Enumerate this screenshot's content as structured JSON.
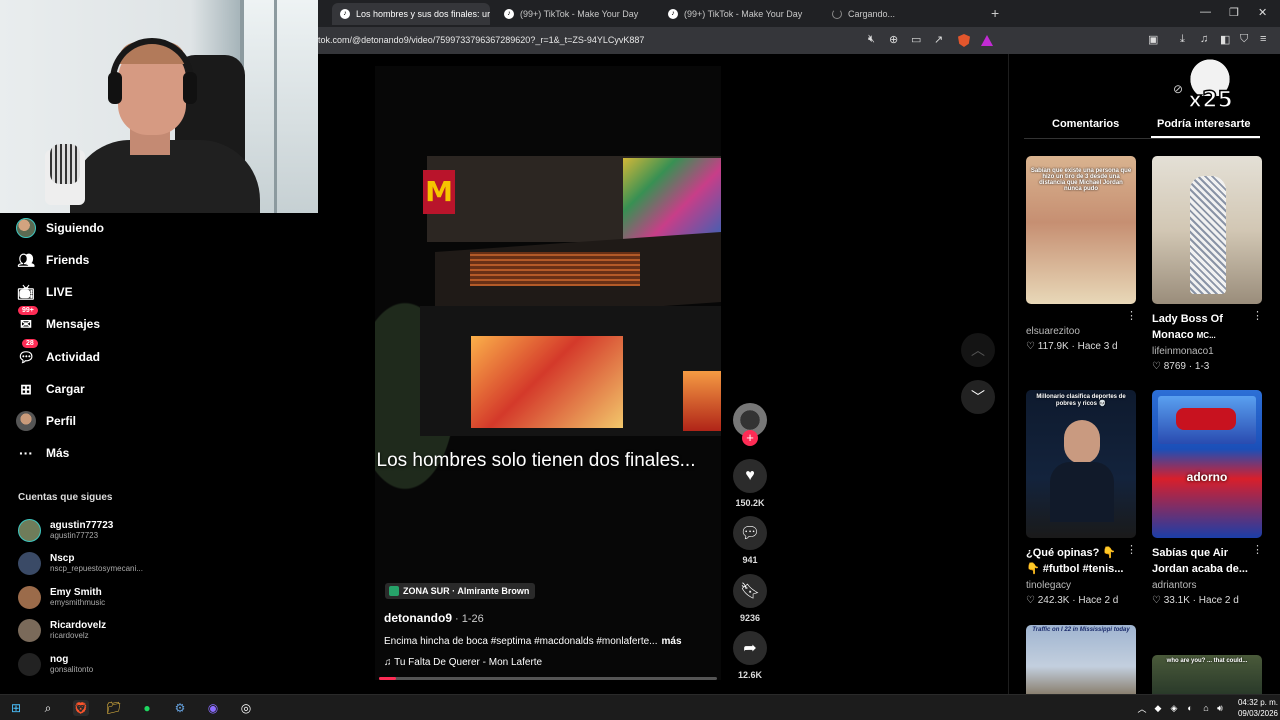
{
  "browser": {
    "tabs": [
      {
        "label": "Los hombres y sus dos finales: ur",
        "close": "✕",
        "active": true
      },
      {
        "label": "(99+) TikTok - Make Your Day",
        "active": false
      },
      {
        "label": "(99+) TikTok - Make Your Day",
        "active": false
      },
      {
        "label": "Cargando...",
        "active": false
      }
    ],
    "new_tab": "+",
    "url": "tok.com/@detonando9/video/7599733796367289620?_r=1&_t=ZS-94YLCyvK887",
    "window_controls": [
      "—",
      "❐",
      "✕"
    ]
  },
  "sidebar": {
    "items": [
      {
        "label": "Siguiendo",
        "icon": "avatar-icon"
      },
      {
        "label": "Friends",
        "icon": "friends-icon"
      },
      {
        "label": "LIVE",
        "icon": "live-icon"
      },
      {
        "label": "Mensajes",
        "icon": "messages-icon",
        "badge": "99+"
      },
      {
        "label": "Actividad",
        "icon": "activity-icon",
        "badge": "28"
      },
      {
        "label": "Cargar",
        "icon": "upload-icon"
      },
      {
        "label": "Perfil",
        "icon": "profile-icon"
      },
      {
        "label": "Más",
        "icon": "more-icon"
      }
    ],
    "following_title": "Cuentas que sigues",
    "accounts": [
      {
        "name": "agustin77723",
        "handle": "agustin77723",
        "color": "#6f7c5a"
      },
      {
        "name": "Nscp",
        "handle": "nscp_repuestosymecani...",
        "color": "#3a4a66"
      },
      {
        "name": "Emy Smith",
        "handle": "emysmithmusic",
        "color": "#9b6b4a"
      },
      {
        "name": "Ricardovelz",
        "handle": "ricardovelz",
        "color": "#7a6a5a"
      },
      {
        "name": "nog",
        "handle": "gonsalitonto",
        "color": "#222222"
      }
    ]
  },
  "video": {
    "caption": "Los hombres solo tienen dos finales...",
    "location": "ZONA SUR · Almirante Brown",
    "author": "detonando9",
    "date": " · 1-26",
    "description": "Encima hincha de boca #septima #macdonalds #monlaferte...",
    "more": "más",
    "music": "♫  Tu Falta De Querer - Mon Laferte",
    "progress": 0.05
  },
  "actions": {
    "likes": "150.2K",
    "comments": "941",
    "saves": "9236",
    "shares": "12.6K"
  },
  "right_panel": {
    "tabs": [
      "Comentarios",
      "Podría interesarte"
    ],
    "active_tab": "Podría interesarte",
    "overlay_text": "x25",
    "cards": [
      {
        "title": "",
        "author": "elsuarezitoo",
        "likes": "117.9K",
        "time": "Hace 3 d",
        "thumb_text": "Sabían que existe una persona que hizo un tiro de 3 desde una distancia que Michael Jordan nunca pudo"
      },
      {
        "title": "Lady Boss Of Monaco",
        "title_suffix": "MC...",
        "author": "lifeinmonaco1",
        "likes": "8769",
        "time": "1-3",
        "thumb_text": ""
      },
      {
        "title": "¿Qué opinas? 👇👇 #futbol #tenis...",
        "author": "tinolegacy",
        "likes": "242.3K",
        "time": "Hace 2 d",
        "thumb_text": "Millonario clasifica deportes de pobres y ricos 💀"
      },
      {
        "title": "Sabías que Air Jordan acaba de...",
        "author": "adriantors",
        "likes": "33.1K",
        "time": "Hace 2 d",
        "thumb_text": "adorno"
      },
      {
        "title": "",
        "author": "",
        "likes": "",
        "time": "",
        "thumb_text": "Traffic on I 22 in Mississippi today"
      },
      {
        "title": "",
        "author": "",
        "likes": "",
        "time": "",
        "thumb_text": "who are you? ... that could..."
      }
    ]
  },
  "taskbar": {
    "time": "04:32 p. m.",
    "date": "09/03/2026"
  }
}
